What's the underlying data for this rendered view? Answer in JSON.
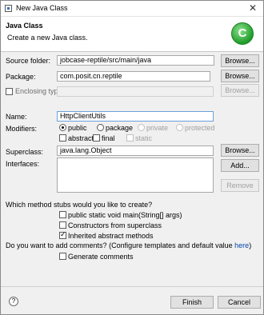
{
  "window": {
    "title": "New Java Class",
    "close_icon": "close-icon"
  },
  "banner": {
    "heading": "Java Class",
    "subtitle": "Create a new Java class.",
    "logo_icon": "new-class-wizard-icon",
    "logo_glyph": "C"
  },
  "form": {
    "source_folder": {
      "label": "Source folder:",
      "value": "jobcase-reptile/src/main/java",
      "browse": "Browse..."
    },
    "package": {
      "label": "Package:",
      "value": "com.posit.cn.reptile",
      "browse": "Browse..."
    },
    "enclosing_type": {
      "label": "Enclosing type:",
      "value": "",
      "browse": "Browse...",
      "checked": false
    },
    "name": {
      "label": "Name:",
      "value": "HttpClientUtils"
    },
    "modifiers": {
      "label": "Modifiers:",
      "access": [
        "public",
        "package",
        "private",
        "protected"
      ],
      "selected": "public",
      "flags": [
        "abstract",
        "final",
        "static"
      ]
    },
    "superclass": {
      "label": "Superclass:",
      "value": "java.lang.Object",
      "browse": "Browse..."
    },
    "interfaces": {
      "label": "Interfaces:",
      "add": "Add...",
      "remove": "Remove"
    },
    "stubs": {
      "question": "Which method stubs would you like to create?",
      "items": [
        {
          "label": "public static void main(String[] args)",
          "checked": false
        },
        {
          "label": "Constructors from superclass",
          "checked": false
        },
        {
          "label": "Inherited abstract methods",
          "checked": true
        }
      ]
    },
    "comments": {
      "question": "Do you want to add comments? (Configure templates and default value ",
      "link": "here",
      "question_end": ")",
      "item": {
        "label": "Generate comments",
        "checked": false
      }
    }
  },
  "footer": {
    "help_glyph": "?",
    "finish": "Finish",
    "cancel": "Cancel"
  }
}
